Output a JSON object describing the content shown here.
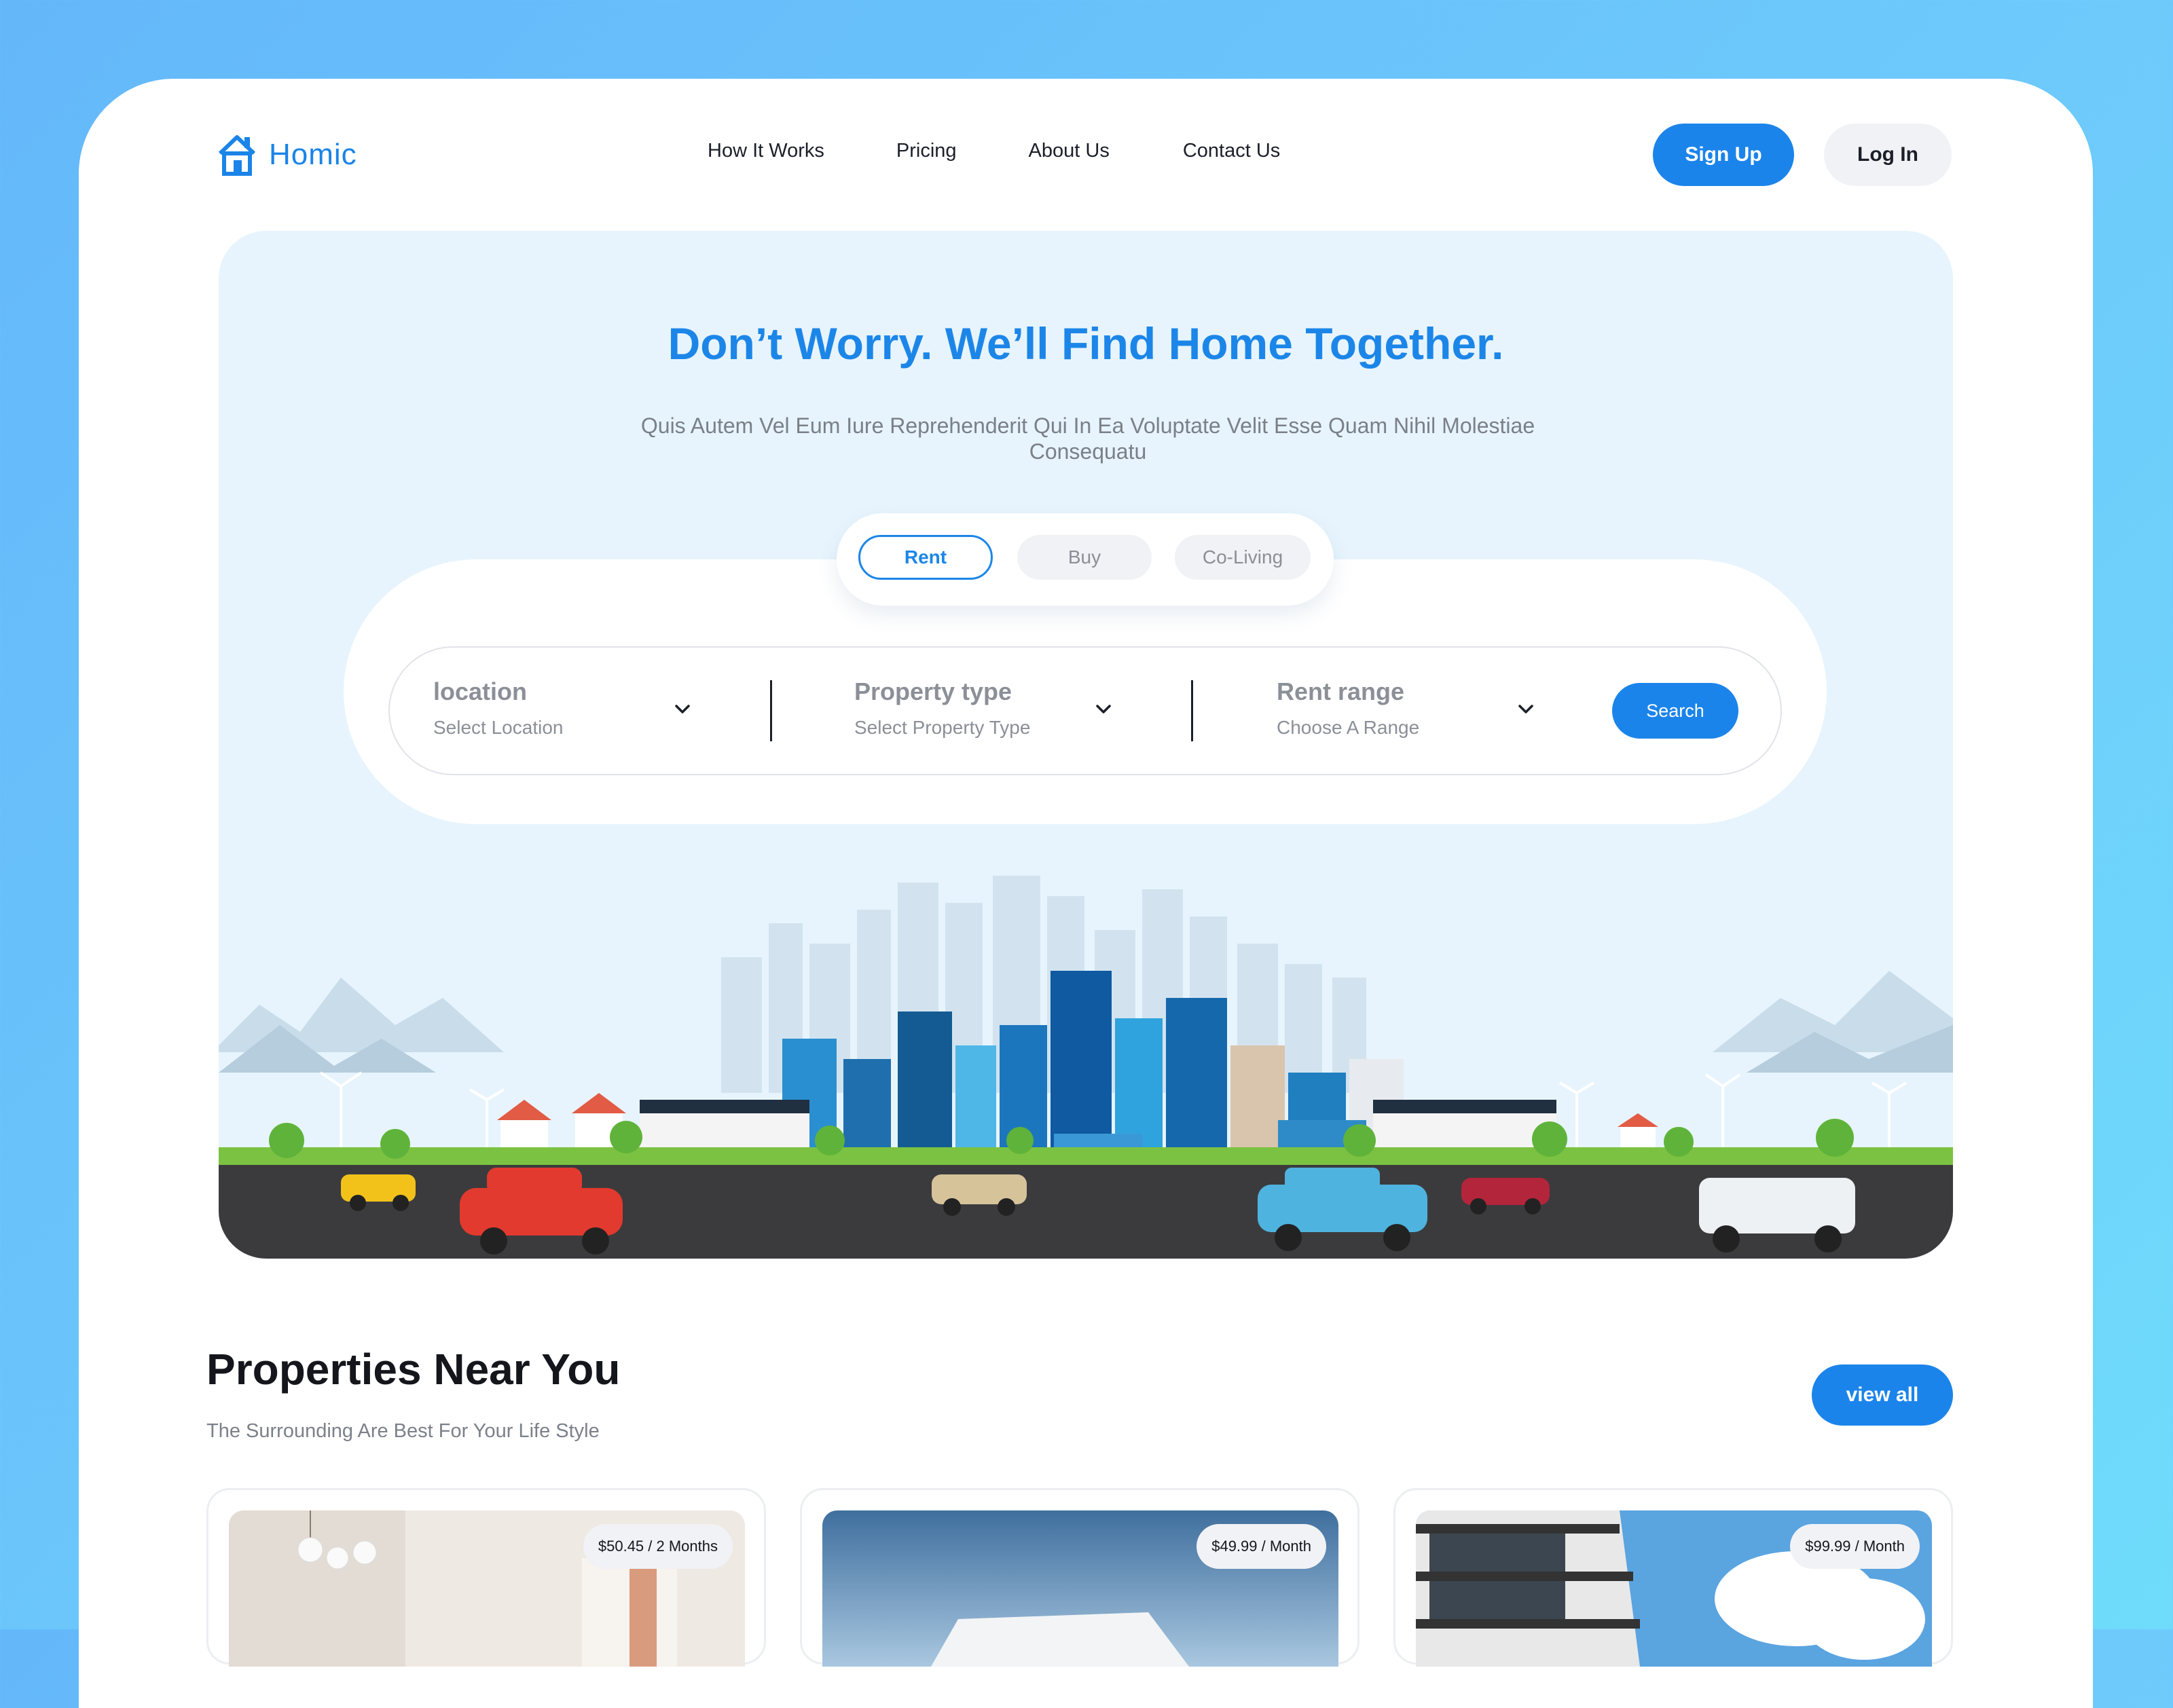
{
  "brand": {
    "name": "Homic"
  },
  "nav": {
    "links": [
      "How It Works",
      "Pricing",
      "About Us",
      "Contact Us"
    ],
    "signup_label": "Sign Up",
    "login_label": "Log In"
  },
  "hero": {
    "title": "Don’t Worry. We’ll Find Home Together.",
    "subtitle": "Quis Autem Vel Eum Iure Reprehenderit Qui In Ea Voluptate Velit Esse Quam Nihil Molestiae Consequatu",
    "tabs": [
      {
        "label": "Rent",
        "active": true
      },
      {
        "label": "Buy",
        "active": false
      },
      {
        "label": "Co-Living",
        "active": false
      }
    ],
    "search": {
      "fields": [
        {
          "label": "location",
          "placeholder": "Select Location"
        },
        {
          "label": "Property type",
          "placeholder": "Select Property Type"
        },
        {
          "label": "Rent range",
          "placeholder": "Choose A Range"
        }
      ],
      "button_label": "Search"
    },
    "illustration": "city-skyline-with-cars"
  },
  "properties": {
    "title": "Properties Near You",
    "subtitle": "The Surrounding Are Best For Your Life Style",
    "view_all_label": "view all",
    "cards": [
      {
        "price": "$50.45 / 2 Months",
        "image": "interior-room"
      },
      {
        "price": "$49.99 / Month",
        "image": "white-building-sky"
      },
      {
        "price": "$99.99 / Month",
        "image": "apartment-balconies"
      }
    ]
  },
  "colors": {
    "accent": "#1b84ea",
    "hero_bg": "#e7f4fd",
    "page_bg": "#6ec6fb"
  },
  "icons": [
    "house-logo-icon",
    "chevron-down-icon"
  ]
}
